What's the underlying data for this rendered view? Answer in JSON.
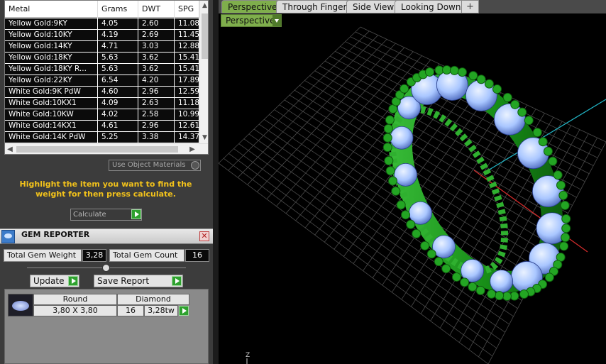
{
  "metal_table": {
    "columns": [
      "Metal",
      "Grams",
      "DWT",
      "SPG"
    ],
    "rows": [
      [
        "Yellow Gold:9KY",
        "4.05",
        "2.60",
        "11.08"
      ],
      [
        "Yellow Gold:10KY",
        "4.19",
        "2.69",
        "11.45"
      ],
      [
        "Yellow Gold:14KY",
        "4.71",
        "3.03",
        "12.88"
      ],
      [
        "Yellow Gold:18KY",
        "5.63",
        "3.62",
        "15.41"
      ],
      [
        "Yellow Gold:18KY R...",
        "5.63",
        "3.62",
        "15.41"
      ],
      [
        "Yellow Gold:22KY",
        "6.54",
        "4.20",
        "17.89"
      ],
      [
        "White Gold:9K PdW",
        "4.60",
        "2.96",
        "12.59"
      ],
      [
        "White Gold:10KX1",
        "4.09",
        "2.63",
        "11.18"
      ],
      [
        "White Gold:10KW",
        "4.02",
        "2.58",
        "10.99"
      ],
      [
        "White Gold:14KX1",
        "4.61",
        "2.96",
        "12.61"
      ],
      [
        "White Gold:14K PdW",
        "5.25",
        "3.38",
        "14.37"
      ]
    ]
  },
  "use_object_materials": "Use Object Materials",
  "highlight_message": "Highlight the item you want to find the weight for then press calculate.",
  "calculate_label": "Calculate",
  "gem_reporter": {
    "title": "GEM REPORTER",
    "total_weight_label": "Total Gem Weight",
    "total_weight_value": "3,28",
    "total_count_label": "Total Gem Count",
    "total_count_value": "16",
    "update_label": "Update",
    "save_report_label": "Save Report",
    "gem": {
      "shape": "Round",
      "material": "Diamond",
      "size": "3,80 X 3,80",
      "count": "16",
      "weight": "3,28tw"
    }
  },
  "viewport": {
    "tabs": [
      "Perspective",
      "Through Finger",
      "Side View",
      "Looking Down"
    ],
    "active_tab": "Perspective",
    "add_tab_symbol": "+",
    "view_dropdown": "Perspective",
    "axis_label": "Z"
  },
  "colors": {
    "tab_active": "#7fae4c",
    "highlight_text": "#f2c21b",
    "ring_metal": "#1e8a1e",
    "gem": "#a9c6ff",
    "axis_x": "#d12b2b",
    "axis_y": "#21b3c4"
  }
}
